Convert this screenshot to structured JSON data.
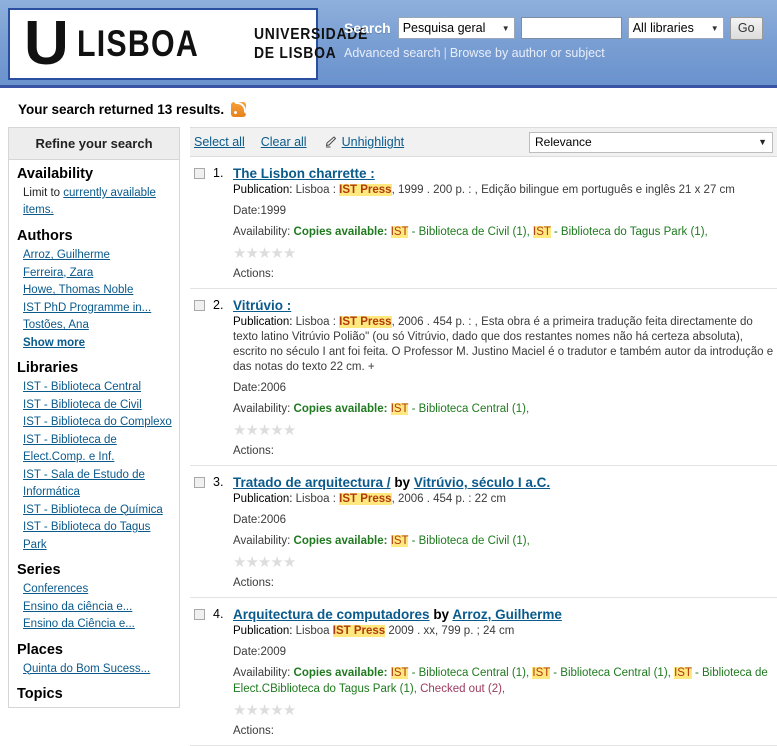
{
  "header": {
    "logo": {
      "letter": "U",
      "wordmark": "LISBOA",
      "univ_line1": "UNIVERSIDADE",
      "univ_line2": "DE LISBOA"
    },
    "search": {
      "label": "Search",
      "query_type": "Pesquisa geral",
      "input_value": "",
      "input_placeholder": "",
      "library_scope": "All libraries",
      "go_label": "Go",
      "advanced_search": "Advanced search",
      "browse_link": "Browse by author or subject"
    }
  },
  "results_summary": {
    "text": "Your search returned 13 results.",
    "count": 13,
    "rss_icon": "rss-icon"
  },
  "sidebar": {
    "title": "Refine your search",
    "groups": [
      {
        "title": "Availability",
        "note_prefix": "Limit to ",
        "note_link": "currently available items.",
        "items": []
      },
      {
        "title": "Authors",
        "items": [
          "Arroz, Guilherme",
          "Ferreira, Zara",
          "Howe, Thomas Noble",
          "IST PhD Programme in...",
          "Tostões, Ana"
        ],
        "more": "Show more"
      },
      {
        "title": "Libraries",
        "items": [
          "IST - Biblioteca Central",
          "IST - Biblioteca de Civil",
          "IST - Biblioteca do Complexo",
          "IST - Biblioteca de Elect.Comp. e Inf.",
          "IST - Sala de Estudo de Informática",
          "IST - Biblioteca de Química",
          "IST - Biblioteca do Tagus Park"
        ]
      },
      {
        "title": "Series",
        "items": [
          "Conferences",
          "Ensino da ciência e...",
          "Ensino da Ciência e..."
        ]
      },
      {
        "title": "Places",
        "items": [
          "Quinta do Bom Sucess..."
        ]
      },
      {
        "title": "Topics",
        "items": []
      }
    ]
  },
  "toolbar": {
    "select_all": "Select all",
    "clear_all": "Clear all",
    "unhighlight": "Unhighlight",
    "unhighlight_icon": "highlighter-pen-icon",
    "sort_value": "Relevance"
  },
  "results": [
    {
      "number": "1.",
      "title": "The Lisbon charrette :",
      "by_word": "",
      "author": "",
      "pub_label": "Publication:",
      "pub_prefix": " Lisboa : ",
      "pub_highlight": "IST Press",
      "pub_suffix": ", 1999 . 200 p. : , Edição bilingue em português e inglês 21 x 27 cm",
      "date_label": "Date:",
      "date_value": "1999",
      "avail_label": "Availability: ",
      "avail_status": "Copies available:",
      "holdings": [
        {
          "hl": "IST",
          "text": " - Biblioteca de Civil (1), "
        },
        {
          "hl": "IST",
          "text": " - Biblioteca do Tagus Park (1),"
        }
      ],
      "checked_out": "",
      "rating": 0,
      "actions_label": "Actions:"
    },
    {
      "number": "2.",
      "title": "Vitrúvio :",
      "by_word": "",
      "author": "",
      "pub_label": "Publication:",
      "pub_prefix": " Lisboa : ",
      "pub_highlight": "IST Press",
      "pub_suffix": ", 2006 . 454 p. : , Esta obra é a primeira tradução feita directamente do texto latino Vitrúvio Polião\" (ou só Vitrúvio, dado que dos restantes nomes não há certeza absoluta), escrito no século I ant foi feita. O Professor M. Justino Maciel é o tradutor e também autor da introdução e das notas do texto 22 cm. +",
      "date_label": "Date:",
      "date_value": "2006",
      "avail_label": "Availability: ",
      "avail_status": "Copies available:",
      "holdings": [
        {
          "hl": "IST",
          "text": " - Biblioteca Central (1),"
        }
      ],
      "checked_out": "",
      "rating": 0,
      "actions_label": "Actions:"
    },
    {
      "number": "3.",
      "title": "Tratado de arquitectura /",
      "by_word": "by",
      "author": "Vitrúvio, século I a.C.",
      "pub_label": "Publication:",
      "pub_prefix": " Lisboa : ",
      "pub_highlight": "IST Press",
      "pub_suffix": ", 2006 . 454 p. : 22 cm",
      "date_label": "Date:",
      "date_value": "2006",
      "avail_label": "Availability: ",
      "avail_status": "Copies available:",
      "holdings": [
        {
          "hl": "IST",
          "text": " - Biblioteca de Civil (1),"
        }
      ],
      "checked_out": "",
      "rating": 0,
      "actions_label": "Actions:"
    },
    {
      "number": "4.",
      "title": "Arquitectura de computadores",
      "by_word": "by",
      "author": "Arroz, Guilherme",
      "pub_label": "Publication:",
      "pub_prefix": " Lisboa ",
      "pub_highlight": "IST Press",
      "pub_suffix": " 2009 . xx, 799 p. ; 24 cm",
      "date_label": "Date:",
      "date_value": "2009",
      "avail_label": "Availability: ",
      "avail_status": "Copies available:",
      "holdings": [
        {
          "hl": "IST",
          "text": " - Biblioteca Central (1), "
        },
        {
          "hl": "IST",
          "text": " - Biblioteca Central (1), "
        },
        {
          "hl": "IST",
          "text": " - Biblioteca de Elect.C"
        },
        {
          "hl": "",
          "text": "Biblioteca do Tagus Park (1), "
        }
      ],
      "checked_out": "Checked out (2),",
      "rating": 0,
      "actions_label": "Actions:"
    }
  ],
  "colors": {
    "header_blue_top": "#8fb0dc",
    "header_blue_bottom": "#6a92cd",
    "header_border": "#3a54a5",
    "link_blue": "#0a5a8c",
    "highlight_bg": "#ffe97f",
    "highlight_fg": "#b03a10",
    "available_green": "#1f7a1f",
    "checked_out_red": "#9c3a5e",
    "rss_orange": "#e8821c"
  }
}
